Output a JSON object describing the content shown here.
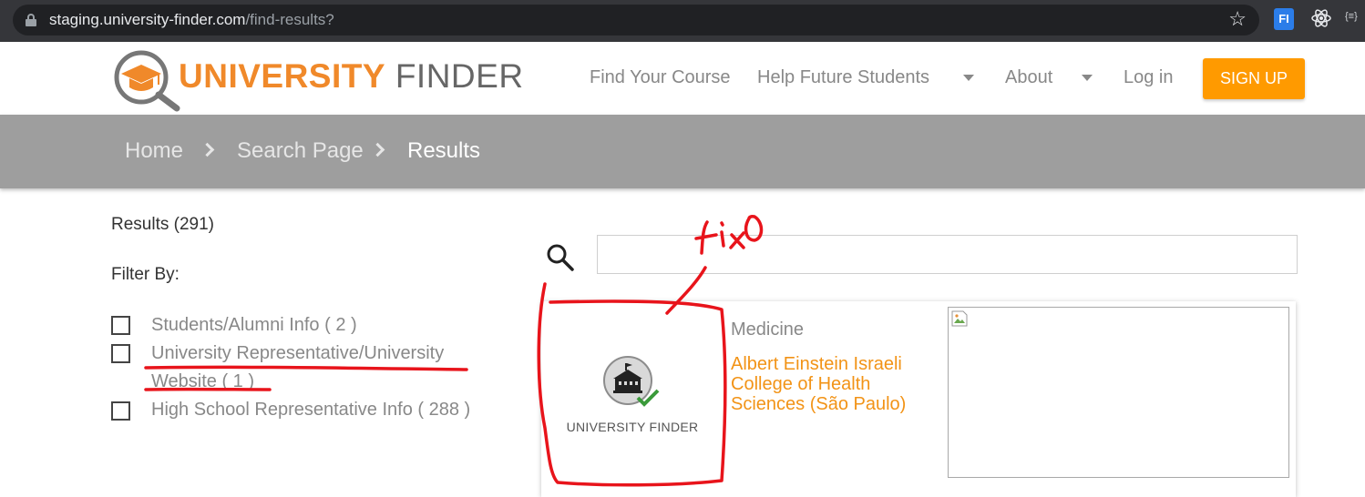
{
  "browser": {
    "url_host": "staging.university-finder.com",
    "url_path": "/find-results?",
    "icons": [
      "lock-icon",
      "star-icon",
      "fi-extension-icon",
      "react-devtools-icon",
      "json-extension-icon"
    ],
    "extension_fi_label": "FI",
    "extension_json_label": "{≡}"
  },
  "header": {
    "brand_part1": "UNIVERSITY",
    "brand_part2": "FINDER",
    "nav": {
      "find_course": "Find Your Course",
      "help_students": "Help Future Students",
      "about": "About",
      "login": "Log in",
      "signup": "SIGN UP"
    }
  },
  "breadcrumb": {
    "items": [
      "Home",
      "Search Page",
      "Results"
    ]
  },
  "sidebar": {
    "results_count": "Results (291)",
    "filter_title": "Filter By:",
    "filters": [
      {
        "label": "Students/Alumni Info ( 2 )",
        "checked": false
      },
      {
        "label": "University Representative/University Website ( 1 )",
        "checked": false
      },
      {
        "label": "High School Representative Info ( 288 )",
        "checked": false
      }
    ]
  },
  "search": {
    "value": "",
    "placeholder": ""
  },
  "results": [
    {
      "thumb_label": "UNIVERSITY FINDER",
      "category": "Medicine",
      "name": "Albert Einstein Israeli College of Health Sciences (São Paulo)"
    }
  ],
  "annotation": {
    "note_text": "fix0",
    "color": "#e8141b"
  },
  "colors": {
    "brand_orange": "#f0892a",
    "signup_orange": "#ff9a00",
    "breadcrumb_bg": "#9e9e9e",
    "result_link": "#f29316"
  }
}
